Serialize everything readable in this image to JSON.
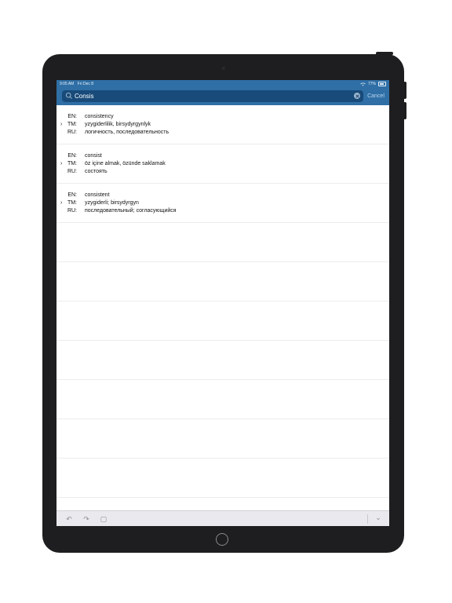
{
  "status_bar": {
    "time": "9:05 AM",
    "date": "Fri Dec 8",
    "battery": "77%"
  },
  "search": {
    "value": "Consis",
    "cancel_label": "Cancel"
  },
  "entries": [
    {
      "en_label": "EN:",
      "en": "consistency",
      "tm_label": "TM:",
      "tm": "yzygiderlilik, birsydyrgynlyk",
      "ru_label": "RU:",
      "ru": "логичность, последовательность"
    },
    {
      "en_label": "EN:",
      "en": "consist",
      "tm_label": "TM:",
      "tm": "öz içine almak, özünde saklamak",
      "ru_label": "RU:",
      "ru": "состоять"
    },
    {
      "en_label": "EN:",
      "en": "consistent",
      "tm_label": "TM:",
      "tm": "yzygiderli; birsydyrgyn",
      "ru_label": "RU:",
      "ru": "последовательный; согласующийся"
    }
  ],
  "icons": {
    "chevron": "›",
    "undo": "↶",
    "redo": "↷",
    "paste": "▢",
    "collapse": "⌄"
  }
}
